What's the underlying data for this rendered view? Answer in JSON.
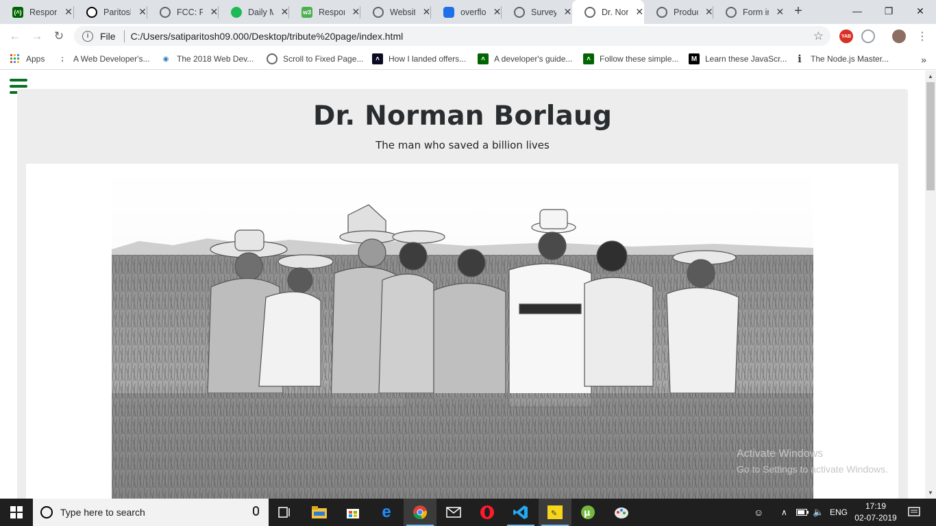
{
  "browser": {
    "tabs": [
      {
        "title": "Respon",
        "icon": "fcc-icon",
        "color": "#006400"
      },
      {
        "title": "Paritosh",
        "icon": "codepen-icon",
        "color": "#000000"
      },
      {
        "title": "FCC: Pe",
        "icon": "globe-icon",
        "color": "#5f6368"
      },
      {
        "title": "Daily M",
        "icon": "spotify-icon",
        "color": "#1db954"
      },
      {
        "title": "Respon",
        "icon": "w3-icon",
        "color": "#4caf50"
      },
      {
        "title": "Website",
        "icon": "globe-icon",
        "color": "#5f6368"
      },
      {
        "title": "overflow",
        "icon": "overflow-icon",
        "color": "#1f6feb"
      },
      {
        "title": "Survey",
        "icon": "globe-icon",
        "color": "#5f6368"
      },
      {
        "title": "Dr. Nor",
        "icon": "globe-icon",
        "color": "#5f6368",
        "active": true
      },
      {
        "title": "Produc",
        "icon": "globe-icon",
        "color": "#5f6368"
      },
      {
        "title": "Form in",
        "icon": "globe-icon",
        "color": "#5f6368"
      }
    ],
    "new_tab": "+",
    "window_controls": {
      "minimize": "—",
      "maximize": "❐",
      "close": "✕"
    },
    "omnibox": {
      "scheme": "File",
      "url": "C:/Users/satiparitosh09.000/Desktop/tribute%20page/index.html"
    },
    "extensions": [
      {
        "label": "YAB",
        "color": "#d93025"
      }
    ],
    "bookmarks": [
      {
        "label": "Apps",
        "icon": "apps-grid-icon"
      },
      {
        "label": "A Web Developer's...",
        "icon": "dots-icon"
      },
      {
        "label": "The 2018 Web Dev...",
        "icon": "eye-icon"
      },
      {
        "label": "Scroll to Fixed Page...",
        "icon": "globe-icon"
      },
      {
        "label": "How I landed offers...",
        "icon": "fcc-dark-icon"
      },
      {
        "label": "A developer's guide...",
        "icon": "fcc-icon"
      },
      {
        "label": "Follow these simple...",
        "icon": "fcc-icon"
      },
      {
        "label": "Learn these JavaScr...",
        "icon": "medium-icon"
      },
      {
        "label": "The Node.js Master...",
        "icon": "info-icon"
      }
    ],
    "bookmarks_more": "»"
  },
  "page": {
    "title": "Dr. Norman Borlaug",
    "subtitle": "The man who saved a billion lives",
    "menu_color": "#0a6e24",
    "card_bg": "#ededed"
  },
  "watermark": {
    "line1": "Activate Windows",
    "line2": "Go to Settings to activate Windows."
  },
  "taskbar": {
    "search_placeholder": "Type here to search",
    "tray": {
      "language": "ENG"
    },
    "time": "17:19",
    "date": "02-07-2019"
  }
}
